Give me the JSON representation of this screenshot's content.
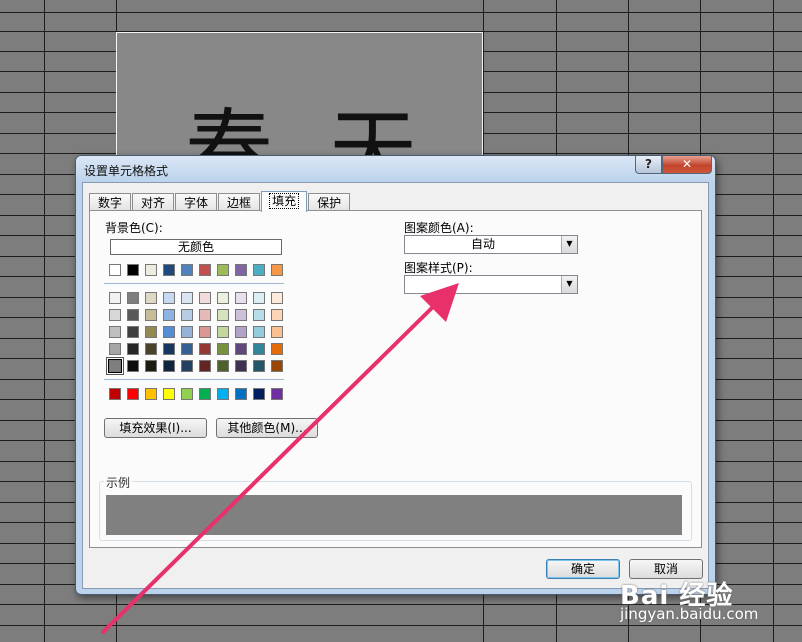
{
  "sheet": {
    "cell_text": [
      "春",
      "天"
    ]
  },
  "dialog": {
    "title": "设置单元格格式",
    "help_label": "?",
    "close_label": "✕",
    "tabs": [
      {
        "label": "数字",
        "active": false
      },
      {
        "label": "对齐",
        "active": false
      },
      {
        "label": "字体",
        "active": false
      },
      {
        "label": "边框",
        "active": false
      },
      {
        "label": "填充",
        "active": true
      },
      {
        "label": "保护",
        "active": false
      }
    ],
    "fill": {
      "background_label": "背景色(C):",
      "no_color_label": "无颜色",
      "fill_effects_button": "填充效果(I)...",
      "more_colors_button": "其他颜色(M)...",
      "pattern_color_label": "图案颜色(A):",
      "pattern_color_value": "自动",
      "pattern_style_label": "图案样式(P):",
      "pattern_style_value": "",
      "sample_label": "示例",
      "sample_color": "#808080"
    },
    "ok_button": "确定",
    "cancel_button": "取消"
  },
  "palette": {
    "theme_top": [
      "#ffffff",
      "#000000",
      "#eeece1",
      "#1f497d",
      "#4f81bd",
      "#c0504d",
      "#9bbb59",
      "#8064a2",
      "#4bacc6",
      "#f79646"
    ],
    "shades": [
      [
        "#f2f2f2",
        "#7f7f7f",
        "#ddd9c3",
        "#c6d9f0",
        "#dbe5f1",
        "#f2dcdb",
        "#ebf1dd",
        "#e5e0ec",
        "#dbeef3",
        "#fdeada"
      ],
      [
        "#d8d8d8",
        "#595959",
        "#c4bd97",
        "#8db3e2",
        "#b8cce4",
        "#e5b9b7",
        "#d7e3bc",
        "#ccc1d9",
        "#b7dde8",
        "#fbd5b5"
      ],
      [
        "#bfbfbf",
        "#3f3f3f",
        "#938953",
        "#548dd4",
        "#95b3d7",
        "#d99694",
        "#c3d69b",
        "#b2a2c7",
        "#92cddc",
        "#fac08f"
      ],
      [
        "#a5a5a5",
        "#262626",
        "#494429",
        "#17365d",
        "#366092",
        "#953734",
        "#76923c",
        "#5f497a",
        "#31859b",
        "#e36c09"
      ],
      [
        "#7f7f7f",
        "#0c0c0c",
        "#1d1b10",
        "#0f243e",
        "#244061",
        "#632423",
        "#4f6128",
        "#3f3151",
        "#205867",
        "#974806"
      ]
    ],
    "standard": [
      "#c00000",
      "#ff0000",
      "#ffc000",
      "#ffff00",
      "#92d050",
      "#00b050",
      "#00b0f0",
      "#0070c0",
      "#002060",
      "#7030a0"
    ],
    "selected": "#7f7f7f"
  },
  "annotation": {
    "arrow_color": "#e8306a"
  },
  "watermark": {
    "logo": "Bai 经验",
    "url": "jingyan.baidu.com"
  }
}
